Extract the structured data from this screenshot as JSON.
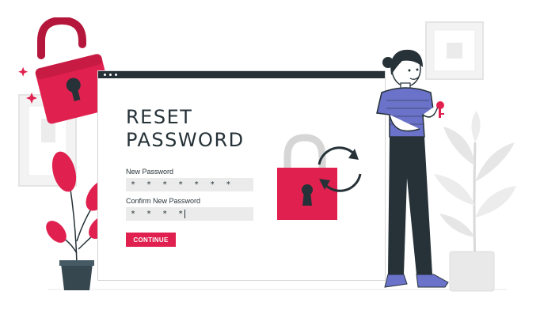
{
  "reset_form": {
    "title_line1": "RESET",
    "title_line2": "PASSWORD",
    "new_password_label": "New Password",
    "new_password_value": "* * * * * * *",
    "confirm_password_label": "Confirm New Password",
    "confirm_password_value": "* * * *",
    "continue_label": "CONTINUE"
  },
  "icons": {
    "open_padlock": "unlocked-padlock-icon",
    "closed_padlock": "locked-padlock-icon",
    "refresh": "refresh-arrows-icon",
    "key": "key-icon"
  },
  "colors": {
    "accent": "#e0204e",
    "accent_dark": "#b5173c",
    "dark": "#263238",
    "field_bg": "#ebebeb",
    "shirt": "#6a72c9"
  }
}
